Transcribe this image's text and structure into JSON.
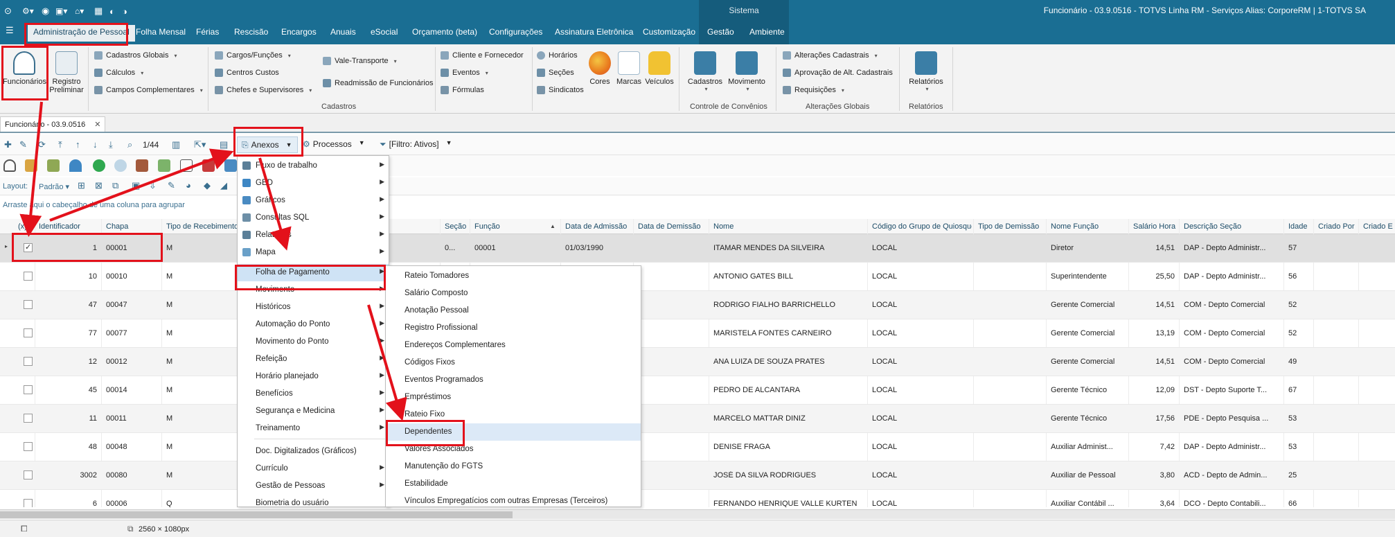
{
  "system_label": "Sistema",
  "window_title": "Funcionário - 03.9.0516 - TOTVS Linha RM - Serviços  Alias: CorporeRM | 1-TOTVS SA",
  "tabs": [
    "Administração de Pessoal",
    "Folha Mensal",
    "Férias",
    "Rescisão",
    "Encargos",
    "Anuais",
    "eSocial",
    "Orçamento (beta)",
    "Configurações",
    "Assinatura Eletrônica",
    "Customização",
    "Gestão",
    "Ambiente"
  ],
  "ribbon": {
    "funcionarios": "Funcionários",
    "registro_preliminar_1": "Registro",
    "registro_preliminar_2": "Preliminar",
    "cadastros_globais": "Cadastros Globais",
    "calculos": "Cálculos",
    "campos_complementares": "Campos Complementares",
    "cargos_funcoes": "Cargos/Funções",
    "centros_custos": "Centros Custos",
    "chefes": "Chefes e Supervisores",
    "vale_transporte": "Vale-Transporte",
    "readmissao": "Readmissão de Funcionários",
    "cliente_fornecedor": "Cliente e Fornecedor",
    "eventos": "Eventos",
    "formulas": "Fórmulas",
    "horarios": "Horários",
    "secoes": "Seções",
    "sindicatos": "Sindicatos",
    "cores": "Cores",
    "marcas": "Marcas",
    "veiculos": "Veículos",
    "cadastros_btn": "Cadastros",
    "movimento_btn": "Movimento",
    "alteracoes_cadastrais": "Alterações Cadastrais",
    "aprovacao": "Aprovação de Alt. Cadastrais",
    "requisicoes": "Requisições",
    "relatorios_btn": "Relatórios",
    "group_cadastros": "Cadastros",
    "group_convenios": "Controle de Convênios",
    "group_alteracoes": "Alterações Globais",
    "group_relatorios": "Relatórios"
  },
  "doc_tab": "Funcionário - 03.9.0516",
  "toolbar": {
    "record_counter": "1/44",
    "anexos": "Anexos",
    "processos": "Processos",
    "filtro": "[Filtro: Ativos]",
    "layout_label": "Layout:",
    "layout_value": "Padrão"
  },
  "group_hint": "Arraste aqui o cabeçalho de uma coluna para agrupar",
  "grid": {
    "headers": [
      "(x)",
      "Identificador",
      "Chapa",
      "Tipo de Recebimento",
      "Funcionário",
      "Seção",
      "Função",
      "Data de Admissão",
      "Data de Demissão",
      "Nome",
      "Código do Grupo de Quiosque",
      "Tipo de Demissão",
      "Nome Função",
      "Salário Hora",
      "Descrição Seção",
      "Idade",
      "Criado Por",
      "Criado E"
    ],
    "rows": [
      {
        "checked": true,
        "id": "1",
        "chapa": "00001",
        "tipo": "M",
        "secao": "0...",
        "funcao": "00001",
        "admissao": "01/03/1990",
        "nome": "ITAMAR MENDES DA SILVEIRA",
        "quiosque": "LOCAL",
        "nome_funcao": "Diretor",
        "salario": "14,51",
        "desc_secao": "DAP - Depto Administr...",
        "idade": "57"
      },
      {
        "checked": false,
        "id": "10",
        "chapa": "00010",
        "tipo": "M",
        "secao": "",
        "funcao": "",
        "admissao": "",
        "nome": "ANTONIO GATES BILL",
        "quiosque": "LOCAL",
        "nome_funcao": "Superintendente",
        "salario": "25,50",
        "desc_secao": "DAP - Depto Administr...",
        "idade": "56"
      },
      {
        "checked": false,
        "id": "47",
        "chapa": "00047",
        "tipo": "M",
        "secao": "",
        "funcao": "",
        "admissao": "",
        "nome": "RODRIGO FIALHO BARRICHELLO",
        "quiosque": "LOCAL",
        "nome_funcao": "Gerente Comercial",
        "salario": "14,51",
        "desc_secao": "COM - Depto Comercial",
        "idade": "52"
      },
      {
        "checked": false,
        "id": "77",
        "chapa": "00077",
        "tipo": "M",
        "secao": "",
        "funcao": "",
        "admissao": "",
        "nome": "MARISTELA FONTES CARNEIRO",
        "quiosque": "LOCAL",
        "nome_funcao": "Gerente Comercial",
        "salario": "13,19",
        "desc_secao": "COM - Depto Comercial",
        "idade": "52"
      },
      {
        "checked": false,
        "id": "12",
        "chapa": "00012",
        "tipo": "M",
        "secao": "",
        "funcao": "",
        "admissao": "",
        "nome": "ANA LUIZA  DE SOUZA PRATES",
        "quiosque": "LOCAL",
        "nome_funcao": "Gerente Comercial",
        "salario": "14,51",
        "desc_secao": "COM - Depto Comercial",
        "idade": "49"
      },
      {
        "checked": false,
        "id": "45",
        "chapa": "00014",
        "tipo": "M",
        "secao": "",
        "funcao": "",
        "admissao": "",
        "nome": "PEDRO DE ALCANTARA",
        "quiosque": "LOCAL",
        "nome_funcao": "Gerente Técnico",
        "salario": "12,09",
        "desc_secao": "DST - Depto Suporte T...",
        "idade": "67"
      },
      {
        "checked": false,
        "id": "11",
        "chapa": "00011",
        "tipo": "M",
        "secao": "",
        "funcao": "",
        "admissao": "",
        "nome": "MARCELO MATTAR DINIZ",
        "quiosque": "LOCAL",
        "nome_funcao": "Gerente Técnico",
        "salario": "17,56",
        "desc_secao": "PDE - Depto Pesquisa ...",
        "idade": "53"
      },
      {
        "checked": false,
        "id": "48",
        "chapa": "00048",
        "tipo": "M",
        "secao": "",
        "funcao": "",
        "admissao": "",
        "nome": "DENISE FRAGA",
        "quiosque": "LOCAL",
        "nome_funcao": "Auxiliar Administ...",
        "salario": "7,42",
        "desc_secao": "DAP - Depto Administr...",
        "idade": "53"
      },
      {
        "checked": false,
        "id": "3002",
        "chapa": "00080",
        "tipo": "M",
        "secao": "",
        "funcao": "",
        "admissao": "",
        "nome": "JOSÉ DA SILVA RODRIGUES",
        "quiosque": "LOCAL",
        "nome_funcao": "Auxiliar de Pessoal",
        "salario": "3,80",
        "desc_secao": "ACD - Depto de Admin...",
        "idade": "25"
      },
      {
        "checked": false,
        "id": "6",
        "chapa": "00006",
        "tipo": "Q",
        "secao": "",
        "funcao": "",
        "admissao": "",
        "nome": "FERNANDO HENRIQUE VALLE KURTEN",
        "quiosque": "LOCAL",
        "nome_funcao": "Auxiliar Contábil ...",
        "salario": "3,64",
        "desc_secao": "DCO - Depto Contabili...",
        "idade": "66"
      }
    ]
  },
  "menu_anexos": [
    {
      "label": "Fluxo de trabalho",
      "sub": true
    },
    {
      "label": "GED",
      "sub": true
    },
    {
      "label": "Gráficos",
      "sub": true
    },
    {
      "label": "Consultas SQL",
      "sub": true
    },
    {
      "label": "Relatórios",
      "sub": true
    },
    {
      "label": "Mapa",
      "sub": true
    },
    {
      "label": "Folha de Pagamento",
      "sub": true
    },
    {
      "label": "Movimento",
      "sub": true
    },
    {
      "label": "Históricos",
      "sub": true
    },
    {
      "label": "Automação do Ponto",
      "sub": true
    },
    {
      "label": "Movimento do Ponto",
      "sub": true
    },
    {
      "label": "Refeição",
      "sub": true
    },
    {
      "label": "Horário planejado",
      "sub": true
    },
    {
      "label": "Benefícios",
      "sub": true
    },
    {
      "label": "Segurança e Medicina",
      "sub": true
    },
    {
      "label": "Treinamento",
      "sub": true
    },
    {
      "label": "Doc. Digitalizados (Gráficos)",
      "sub": false
    },
    {
      "label": "Currículo",
      "sub": true
    },
    {
      "label": "Gestão de Pessoas",
      "sub": true
    },
    {
      "label": "Biometria do usuário",
      "sub": false
    }
  ],
  "menu_folha": [
    "Rateio Tomadores",
    "Salário Composto",
    "Anotação Pessoal",
    "Registro Profissional",
    "Endereços Complementares",
    "Códigos Fixos",
    "Eventos Programados",
    "Empréstimos",
    "Rateio Fixo",
    "Dependentes",
    "Valores Associados",
    "Manutenção do FGTS",
    "Estabilidade",
    "Vínculos Empregatícios com outras Empresas (Terceiros)"
  ],
  "status": {
    "resolution": "2560 × 1080px"
  },
  "colors": {
    "titlebar": "#1a6e93",
    "highlight_red": "#e3111b",
    "menu_highlight": "#cfe3f5"
  }
}
